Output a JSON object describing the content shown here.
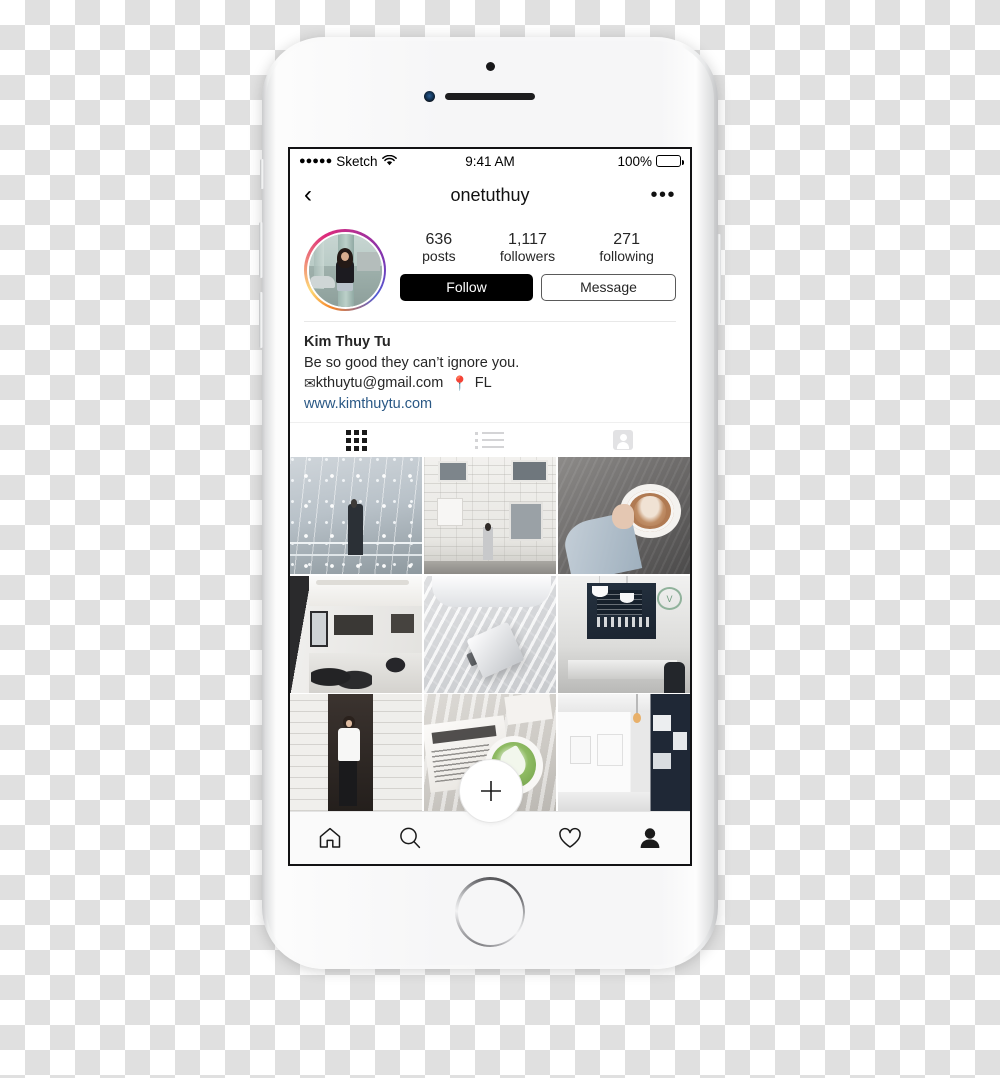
{
  "device": {
    "name": "iphone-mockup",
    "model_label": "iPhone white"
  },
  "status_bar": {
    "signal_dots": "●●●●●",
    "carrier": "Sketch",
    "wifi_icon": "wifi-icon",
    "time": "9:41 AM",
    "battery_percent": "100%",
    "battery_level": 100
  },
  "nav_bar": {
    "back_icon": "chevron-left-icon",
    "back_glyph": "‹",
    "title": "onetuthuy",
    "more_icon": "ellipsis-icon",
    "more_glyph": "•••"
  },
  "profile": {
    "avatar_alt": "onetuthuy profile photo",
    "avatar_has_story_ring": true,
    "stats": [
      {
        "name": "posts",
        "value": "636",
        "label": "posts"
      },
      {
        "name": "followers",
        "value": "1,117",
        "label": "followers"
      },
      {
        "name": "following",
        "value": "271",
        "label": "following"
      }
    ],
    "follow_button": "Follow",
    "message_button": "Message",
    "bio": {
      "display_name": "Kim Thuy Tu",
      "tagline": "Be so good they can’t ignore you.",
      "email_icon": "✉",
      "email": "kthuytu@gmail.com",
      "location_icon": "📍",
      "location": "FL",
      "website": "www.kimthuytu.com"
    }
  },
  "tabs": [
    {
      "name": "tab-grid",
      "icon": "grid-icon",
      "active": true
    },
    {
      "name": "tab-list",
      "icon": "list-icon",
      "active": false
    },
    {
      "name": "tab-tagged",
      "icon": "person-card-icon",
      "active": false
    }
  ],
  "photo_grid": {
    "columns": 3,
    "cells": [
      {
        "id": "post-1",
        "alt": "woman on railing under hanging light bulbs"
      },
      {
        "id": "post-2",
        "alt": "woman standing against white brick wall"
      },
      {
        "id": "post-3",
        "alt": "hand holding latte art cup on dark table"
      },
      {
        "id": "post-4",
        "alt": "bright cafe interior with black chairs"
      },
      {
        "id": "post-5",
        "alt": "laptop on white rumpled bedding"
      },
      {
        "id": "post-6",
        "alt": "coffee shop counter with pendant lamps"
      },
      {
        "id": "post-7",
        "alt": "woman in white tee beside dark doorway"
      },
      {
        "id": "post-8",
        "alt": "newspaper and matcha latte on wood floor"
      },
      {
        "id": "post-9",
        "alt": "white gallery room with navy wall"
      }
    ]
  },
  "bottom_nav": {
    "add_button_icon": "plus-icon",
    "items": [
      {
        "name": "nav-home",
        "icon": "home-icon",
        "active": false
      },
      {
        "name": "nav-search",
        "icon": "search-icon",
        "active": false
      },
      {
        "name": "nav-add",
        "icon": "plus-icon",
        "active": false
      },
      {
        "name": "nav-activity",
        "icon": "heart-icon",
        "active": false
      },
      {
        "name": "nav-profile",
        "icon": "person-icon",
        "active": true
      }
    ]
  },
  "colors": {
    "accent_link": "#2a5885",
    "follow_bg": "#000000",
    "text_primary": "#262626",
    "pin_red": "#d93025"
  }
}
